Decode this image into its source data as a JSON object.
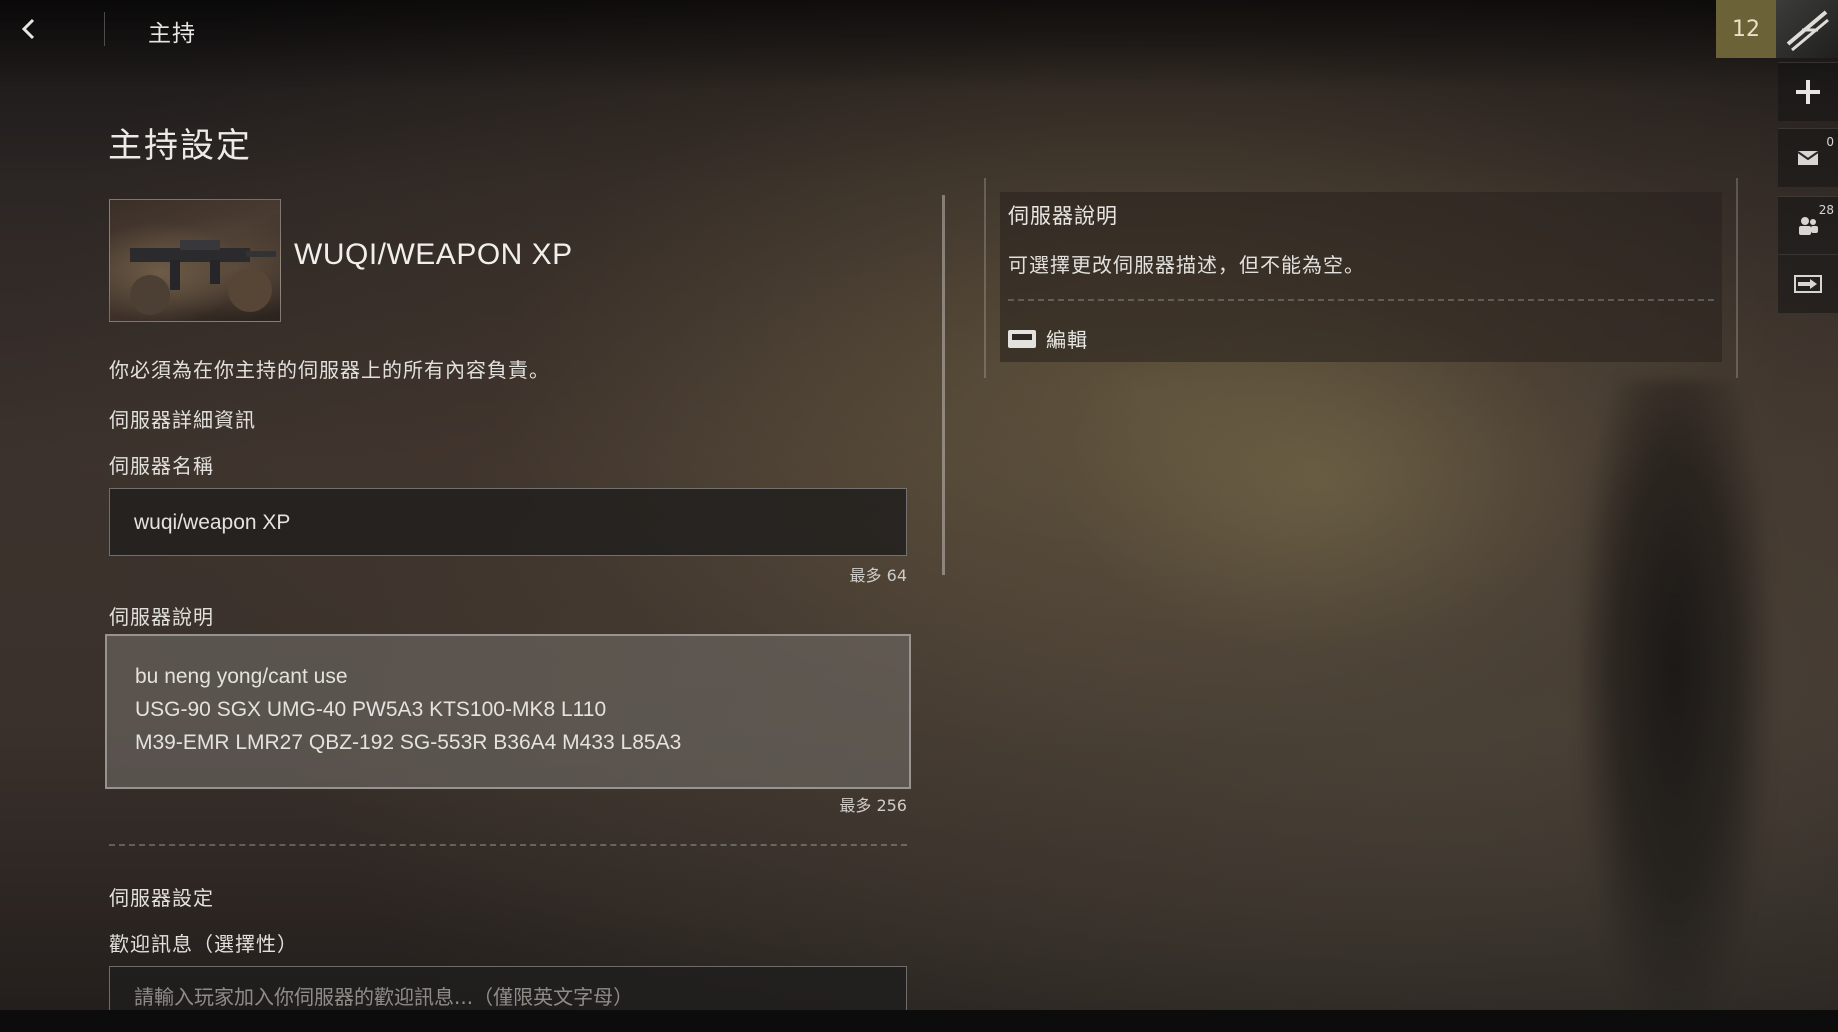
{
  "topbar": {
    "title": "主持"
  },
  "rail": {
    "rank_level": "12",
    "mail_count": "0",
    "party_count": "28"
  },
  "page": {
    "title": "主持設定"
  },
  "server": {
    "display_name": "WUQI/WEAPON XP",
    "responsibility_notice": "你必須為在你主持的伺服器上的所有內容負責。"
  },
  "details_section": {
    "heading": "伺服器詳細資訊",
    "name_label": "伺服器名稱",
    "name_value": "wuqi/weapon XP",
    "name_limit": "最多 64",
    "desc_label": "伺服器說明",
    "desc_lines": [
      "bu neng yong/cant use",
      "USG-90 SGX UMG-40 PW5A3 KTS100-MK8 L110",
      "M39-EMR LMR27 QBZ-192 SG-553R B36A4 M433 L85A3"
    ],
    "desc_limit": "最多 256"
  },
  "settings_section": {
    "heading": "伺服器設定",
    "welcome_label": "歡迎訊息（選擇性）",
    "welcome_placeholder": "請輸入玩家加入你伺服器的歡迎訊息...（僅限英文字母）"
  },
  "side_panel": {
    "title": "伺服器說明",
    "text": "可選擇更改伺服器描述，但不能為空。",
    "edit_label": "編輯"
  },
  "colors": {
    "rank_badge": "#6b6238",
    "text_primary": "#e8e6e2",
    "placeholder": "#8f8c88"
  }
}
